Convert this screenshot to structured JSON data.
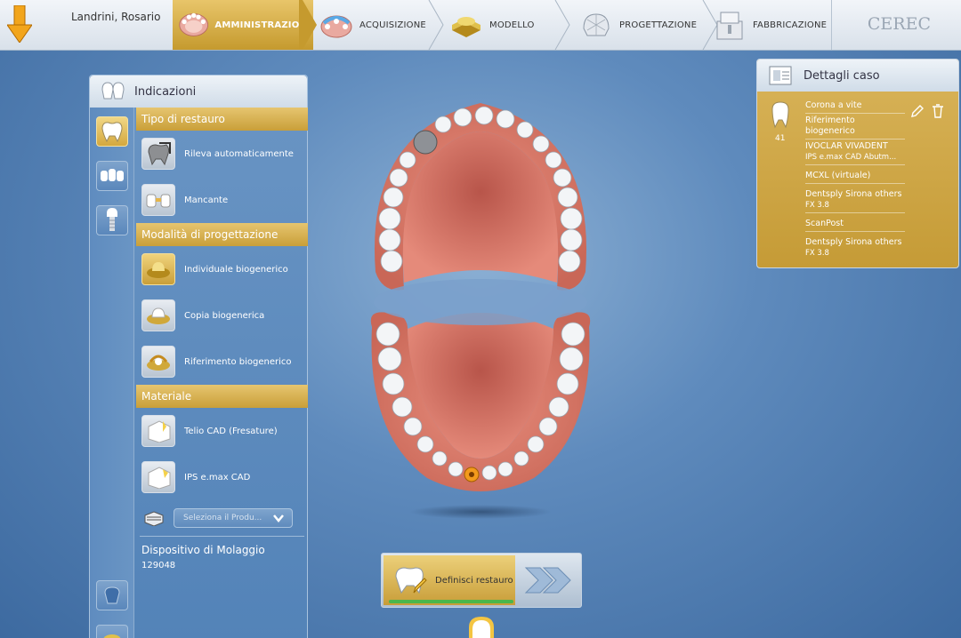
{
  "header": {
    "patient_name": "Landrini, Rosario",
    "brand": "CEREC",
    "steps": [
      {
        "label": "AMMINISTRAZIONE",
        "active": true
      },
      {
        "label": "ACQUISIZIONE",
        "active": false
      },
      {
        "label": "MODELLO",
        "active": false
      },
      {
        "label": "PROGETTAZIONE",
        "active": false
      },
      {
        "label": "FABBRICAZIONE",
        "active": false
      }
    ]
  },
  "indications": {
    "title": "Indicazioni",
    "restoration_type": {
      "title": "Tipo di restauro",
      "options": [
        "Rileva automaticamente",
        "Mancante"
      ]
    },
    "design_mode": {
      "title": "Modalità di progettazione",
      "options": [
        "Individuale biogenerico",
        "Copia biogenerica",
        "Riferimento biogenerico"
      ]
    },
    "material": {
      "title": "Materiale",
      "options": [
        "Telio CAD (Fresature)",
        "IPS e.max CAD"
      ],
      "product_placeholder": "Seleziona il Produ..."
    },
    "device": {
      "title": "Dispositivo di Molaggio",
      "value": "129048"
    }
  },
  "case_details": {
    "title": "Dettagli caso",
    "tooth_number": "41",
    "lines": [
      {
        "main": "Corona a vite"
      },
      {
        "main": "Riferimento biogenerico"
      },
      {
        "main": "IVOCLAR VIVADENT",
        "sub": "IPS e.max CAD Abutm..."
      },
      {
        "main": "MCXL (virtuale)"
      },
      {
        "main": "Dentsply Sirona others",
        "sub": "FX 3.8"
      },
      {
        "main": "ScanPost"
      },
      {
        "main": "Dentsply Sirona others",
        "sub": "FX 3.8"
      }
    ]
  },
  "action": {
    "define_label": "Definisci restauro"
  },
  "colors": {
    "accent_gold": "#c99f39",
    "panel_blue": "#5f8bbd",
    "progress_green": "#4bb64b"
  }
}
